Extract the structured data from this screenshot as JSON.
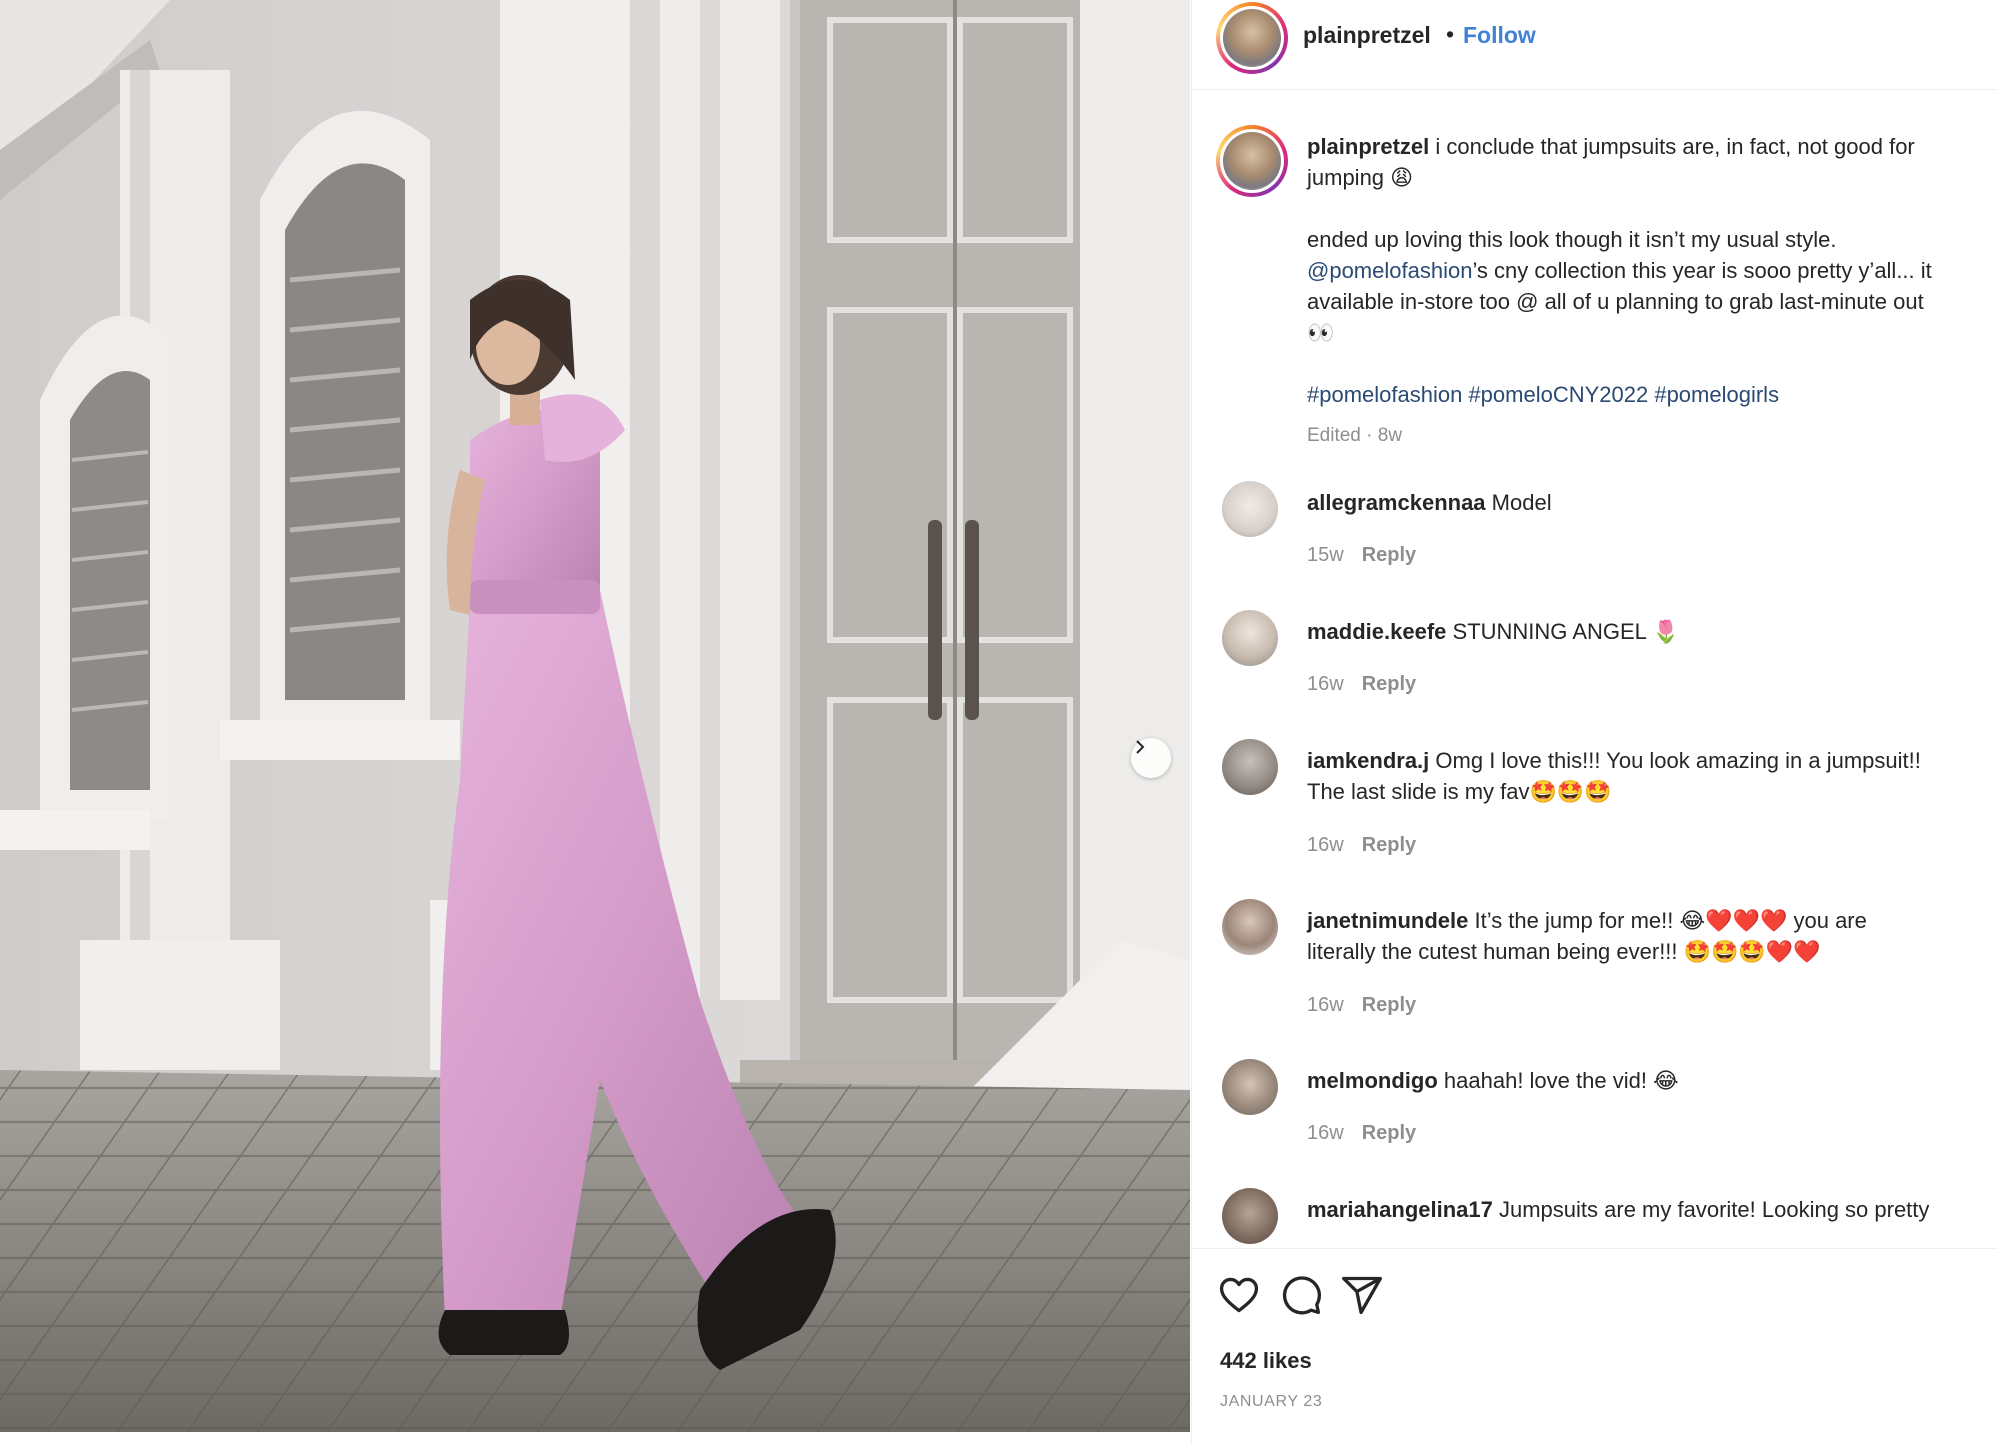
{
  "photo": {
    "alt_icon": "chevron-right-icon"
  },
  "header": {
    "username": "plainpretzel",
    "dot": "•",
    "follow": "Follow"
  },
  "caption": {
    "username": "plainpretzel",
    "line1": "i conclude that jumpsuits are, in fact, not good for",
    "line2": "jumping 😩",
    "para2_line1": "ended up loving this look though it isn’t my usual style.",
    "para2_line2_link": "@pomelofashion",
    "para2_line2_rest": "’s cny collection this year is sooo pretty y’all... it",
    "para2_line3": "available in-store too @ all of u planning to grab last-minute out",
    "para2_line4": "👀",
    "hashtags": "#pomelofashion #pomeloCNY2022 #pomelogirls",
    "meta": "Edited · 8w"
  },
  "comments": [
    {
      "username": "allegramckennaa",
      "lines": [
        "Model"
      ],
      "age": "15w",
      "reply": "Reply"
    },
    {
      "username": "maddie.keefe",
      "lines": [
        "STUNNING ANGEL 🌷"
      ],
      "age": "16w",
      "reply": "Reply"
    },
    {
      "username": "iamkendra.j",
      "lines": [
        "Omg I love this!!! You look amazing in a jumpsuit!!",
        "The last slide is my fav🤩🤩🤩"
      ],
      "age": "16w",
      "reply": "Reply"
    },
    {
      "username": "janetnimundele",
      "lines": [
        "It’s the jump for me!! 😂❤️❤️❤️ you are",
        "literally the cutest human being ever!!! 🤩🤩🤩❤️❤️"
      ],
      "age": "16w",
      "reply": "Reply"
    },
    {
      "username": "melmondigo",
      "lines": [
        "haahah! love the vid! 😂"
      ],
      "age": "16w",
      "reply": "Reply"
    },
    {
      "username": "mariahangelina17",
      "lines": [
        "Jumpsuits are my favorite! Looking so pretty"
      ],
      "age": "",
      "reply": ""
    }
  ],
  "footer": {
    "icons": [
      "heart-icon",
      "comment-icon",
      "share-icon"
    ],
    "likes": "442 likes",
    "date": "JANUARY 23"
  },
  "colors": {
    "link": "#3f82d6",
    "hashtag": "#2b4a73",
    "muted": "#8e8e8e",
    "dress_pink": "#d9a0cf"
  }
}
